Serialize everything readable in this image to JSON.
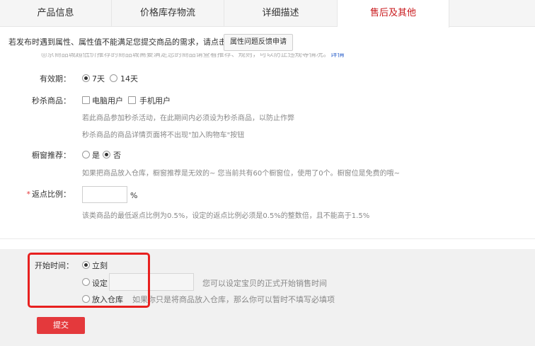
{
  "tabs": [
    {
      "label": "产品信息"
    },
    {
      "label": "价格库存物流"
    },
    {
      "label": "详细描述"
    },
    {
      "label": "售后及其他"
    }
  ],
  "notice": {
    "text": "若发布时遇到属性、属性值不能满足您提交商品的需求，请点击",
    "button": "属性问题反馈申请"
  },
  "clipped": {
    "text": "◎京商品城超低价推荐的商品城需要满足您的商品请查看推荐、规则，可以防止违规等情况。",
    "link": "详情"
  },
  "validity": {
    "label": "有效期：",
    "options": [
      "7天",
      "14天"
    ],
    "selected": "7天"
  },
  "flash_sale": {
    "label": "秒杀商品：",
    "options": [
      "电脑用户",
      "手机用户"
    ],
    "hint1": "若此商品参加秒杀活动，在此期间内必须设为秒杀商品，以防止作弊",
    "hint2": "秒杀商品的商品详情页面将不出现\"加入购物车\"按钮"
  },
  "window": {
    "label": "橱窗推荐：",
    "options": [
      "是",
      "否"
    ],
    "selected": "否",
    "hint": "如果把商品放入仓库，橱窗推荐是无效的~ 您当前共有60个橱窗位，使用了0个。橱窗位是免费的哦~"
  },
  "rebate": {
    "required_mark": "*",
    "label": "返点比例：",
    "value": "",
    "unit": "%",
    "hint": "该类商品的最低返点比例为0.5%，设定的返点比例必须是0.5%的整数倍，且不能高于1.5%"
  },
  "start_time": {
    "label": "开始时间：",
    "option_now": "立刻",
    "option_set": "设定",
    "option_warehouse": "放入仓库",
    "selected": "立刻",
    "set_hint": "您可以设定宝贝的正式开始销售时间",
    "warehouse_hint": "如果你只是将商品放入仓库，那么你可以暂时不填写必填项"
  },
  "submit": {
    "label": "提交"
  },
  "colors": {
    "accent": "#c9191c",
    "submit": "#e4393c",
    "highlight": "#e8201f"
  }
}
